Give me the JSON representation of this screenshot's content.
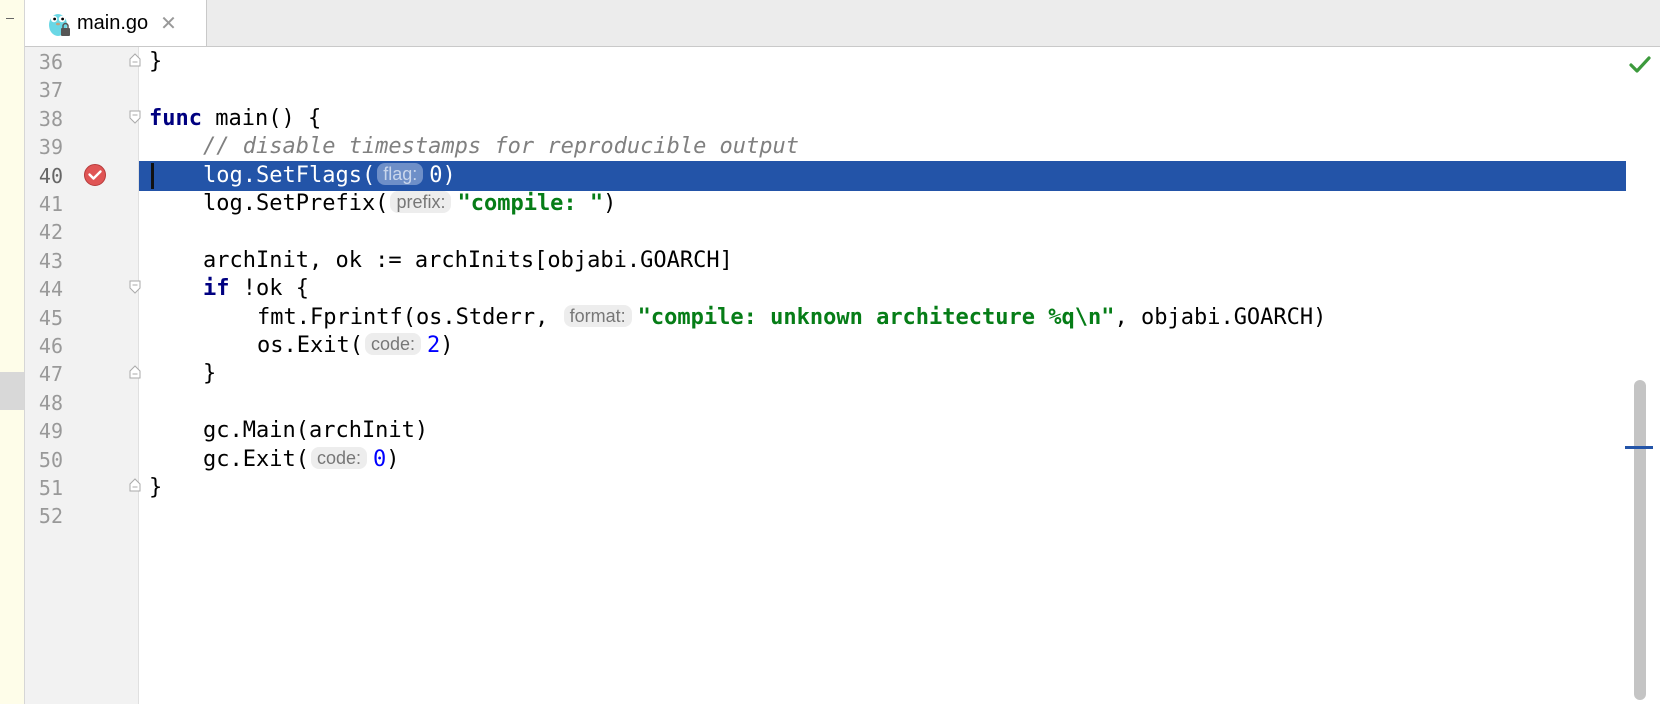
{
  "tab": {
    "file_name": "main.go",
    "close_symbol": "✕",
    "icon": "gopher-icon"
  },
  "line_numbers": [
    "36",
    "37",
    "38",
    "39",
    "40",
    "41",
    "42",
    "43",
    "44",
    "45",
    "46",
    "47",
    "48",
    "49",
    "50",
    "51",
    "52"
  ],
  "code": {
    "l36": "}",
    "l38_kw": "func",
    "l38_rest": " main() {",
    "l39_comment": "// disable timestamps for reproducible output",
    "l40_pre": "log.SetFlags(",
    "l40_hint": "flag:",
    "l40_num": "0",
    "l40_post": ")",
    "l41_pre": "log.SetPrefix(",
    "l41_hint": "prefix:",
    "l41_str": "\"compile: \"",
    "l41_post": ")",
    "l43": "archInit, ok := archInits[objabi.GOARCH]",
    "l44_kw": "if",
    "l44_rest": " !ok {",
    "l45_pre": "fmt.Fprintf(os.Stderr, ",
    "l45_hint": "format:",
    "l45_str": "\"compile: unknown architecture %q\\n\"",
    "l45_post": ", objabi.GOARCH)",
    "l46_pre": "os.Exit(",
    "l46_hint": "code:",
    "l46_num": "2",
    "l46_post": ")",
    "l47": "}",
    "l49": "gc.Main(archInit)",
    "l50_pre": "gc.Exit(",
    "l50_hint": "code:",
    "l50_num": "0",
    "l50_post": ")",
    "l51": "}"
  },
  "colors": {
    "execution_line": "#2354a8",
    "keyword": "#000080",
    "string": "#067d17",
    "number": "#0000ff",
    "comment": "#808080"
  },
  "status": {
    "inspection_icon": "checkmark-icon"
  },
  "breakpoint": {
    "line": "40",
    "icon": "breakpoint-icon"
  }
}
